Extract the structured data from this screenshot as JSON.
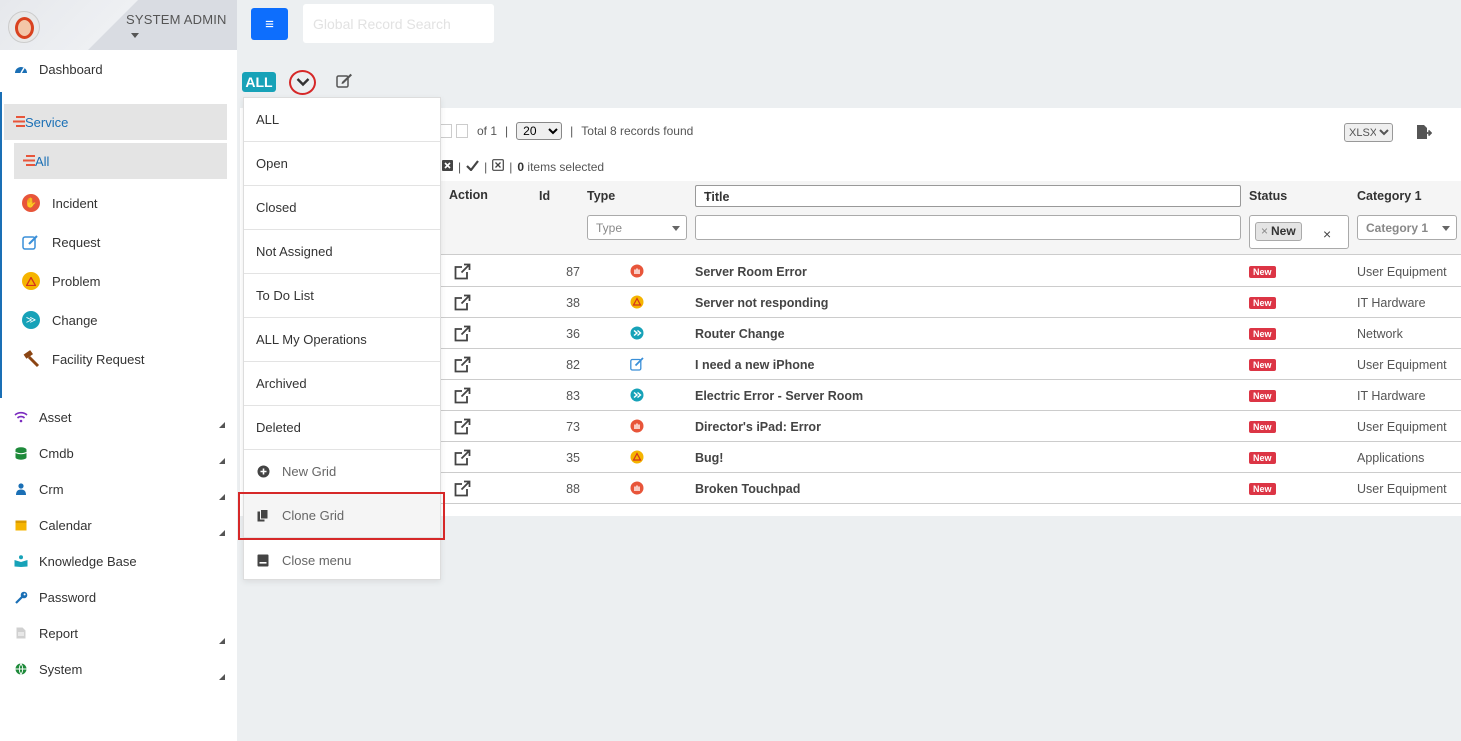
{
  "user": {
    "name": "SYSTEM ADMIN"
  },
  "search": {
    "placeholder": "Global Record Search"
  },
  "sidebar": {
    "dashboard": "Dashboard",
    "service": "Service",
    "service_sub": {
      "all": "All",
      "items": [
        "Incident",
        "Request",
        "Problem",
        "Change",
        "Facility Request"
      ]
    },
    "items": [
      "Asset",
      "Cmdb",
      "Crm",
      "Calendar",
      "Knowledge Base",
      "Password",
      "Report",
      "System"
    ]
  },
  "filter": {
    "badge": "ALL"
  },
  "dropdown": {
    "items": [
      "ALL",
      "Open",
      "Closed",
      "Not Assigned",
      "To Do List",
      "ALL My Operations",
      "Archived",
      "Deleted"
    ],
    "actions": [
      "New Grid",
      "Clone Grid",
      "Close menu"
    ]
  },
  "pager": {
    "of": "of 1",
    "page_size": "20",
    "total": "Total 8 records found",
    "selected_count": "0",
    "selected_label": "items selected",
    "export_format": "XLSX"
  },
  "table": {
    "headers": {
      "action": "Action",
      "id": "Id",
      "type": "Type",
      "title": "Title",
      "status": "Status",
      "category": "Category 1"
    },
    "filters": {
      "type_placeholder": "Type",
      "status_tag": "New",
      "category_placeholder": "Category 1"
    },
    "rows": [
      {
        "id": "87",
        "type": "incident",
        "title": "Server Room Error",
        "status": "New",
        "category": "User Equipment"
      },
      {
        "id": "38",
        "type": "problem",
        "title": "Server not responding",
        "status": "New",
        "category": "IT Hardware"
      },
      {
        "id": "36",
        "type": "change",
        "title": "Router Change",
        "status": "New",
        "category": "Network"
      },
      {
        "id": "82",
        "type": "request",
        "title": "I need a new iPhone",
        "status": "New",
        "category": "User Equipment"
      },
      {
        "id": "83",
        "type": "change",
        "title": "Electric Error - Server Room",
        "status": "New",
        "category": "IT Hardware"
      },
      {
        "id": "73",
        "type": "incident",
        "title": "Director's iPad: Error",
        "status": "New",
        "category": "User Equipment"
      },
      {
        "id": "35",
        "type": "problem",
        "title": "Bug!",
        "status": "New",
        "category": "Applications"
      },
      {
        "id": "88",
        "type": "incident",
        "title": "Broken Touchpad",
        "status": "New",
        "category": "User Equipment"
      }
    ]
  },
  "colors": {
    "primary": "#0d6efd",
    "accent": "#1a6fb5",
    "teal": "#17a2b8",
    "danger": "#dc3545",
    "highlight": "#d62828"
  }
}
